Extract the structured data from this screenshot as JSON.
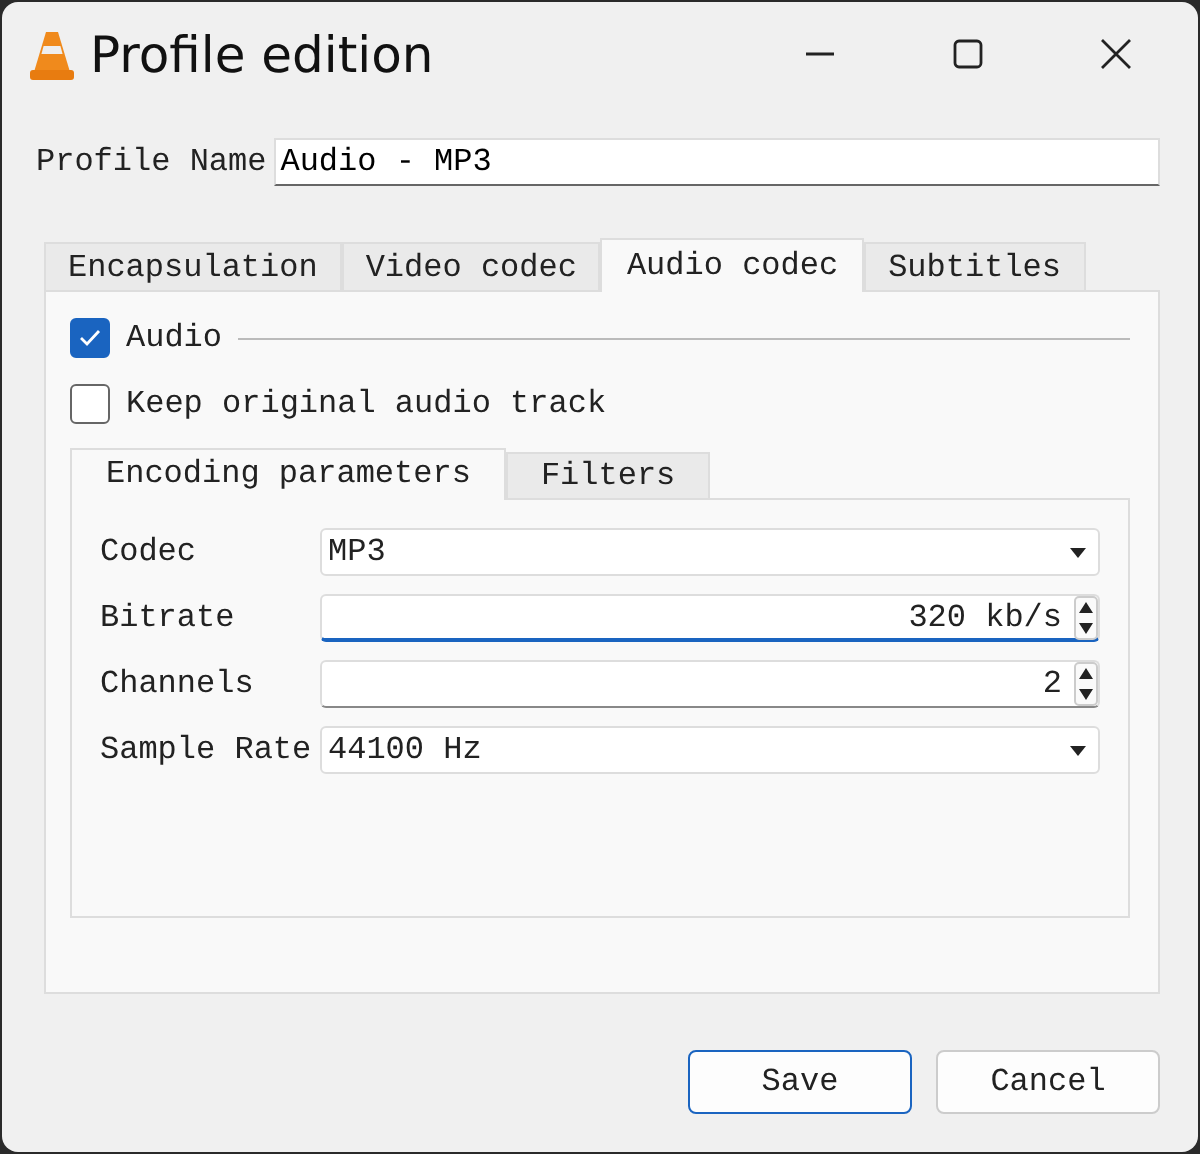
{
  "window": {
    "title": "Profile edition"
  },
  "profile_name": {
    "label": "Profile Name",
    "value": "Audio - MP3"
  },
  "tabs": [
    {
      "label": "Encapsulation",
      "selected": false
    },
    {
      "label": "Video codec",
      "selected": false
    },
    {
      "label": "Audio codec",
      "selected": true
    },
    {
      "label": "Subtitles",
      "selected": false
    }
  ],
  "audio": {
    "label": "Audio",
    "checked": true
  },
  "keep_original": {
    "label": "Keep original audio track",
    "checked": false
  },
  "subtabs": [
    {
      "label": "Encoding parameters",
      "selected": true
    },
    {
      "label": "Filters",
      "selected": false
    }
  ],
  "fields": [
    {
      "label": "Codec",
      "kind": "combo",
      "value": "MP3",
      "focused": false
    },
    {
      "label": "Bitrate",
      "kind": "spin",
      "value": "320 kb/s",
      "focused": true
    },
    {
      "label": "Channels",
      "kind": "spin",
      "value": "2",
      "focused": false
    },
    {
      "label": "Sample Rate",
      "kind": "combo",
      "value": "44100 Hz",
      "focused": false
    }
  ],
  "buttons": [
    {
      "label": "Save",
      "default": true
    },
    {
      "label": "Cancel",
      "default": false
    }
  ]
}
